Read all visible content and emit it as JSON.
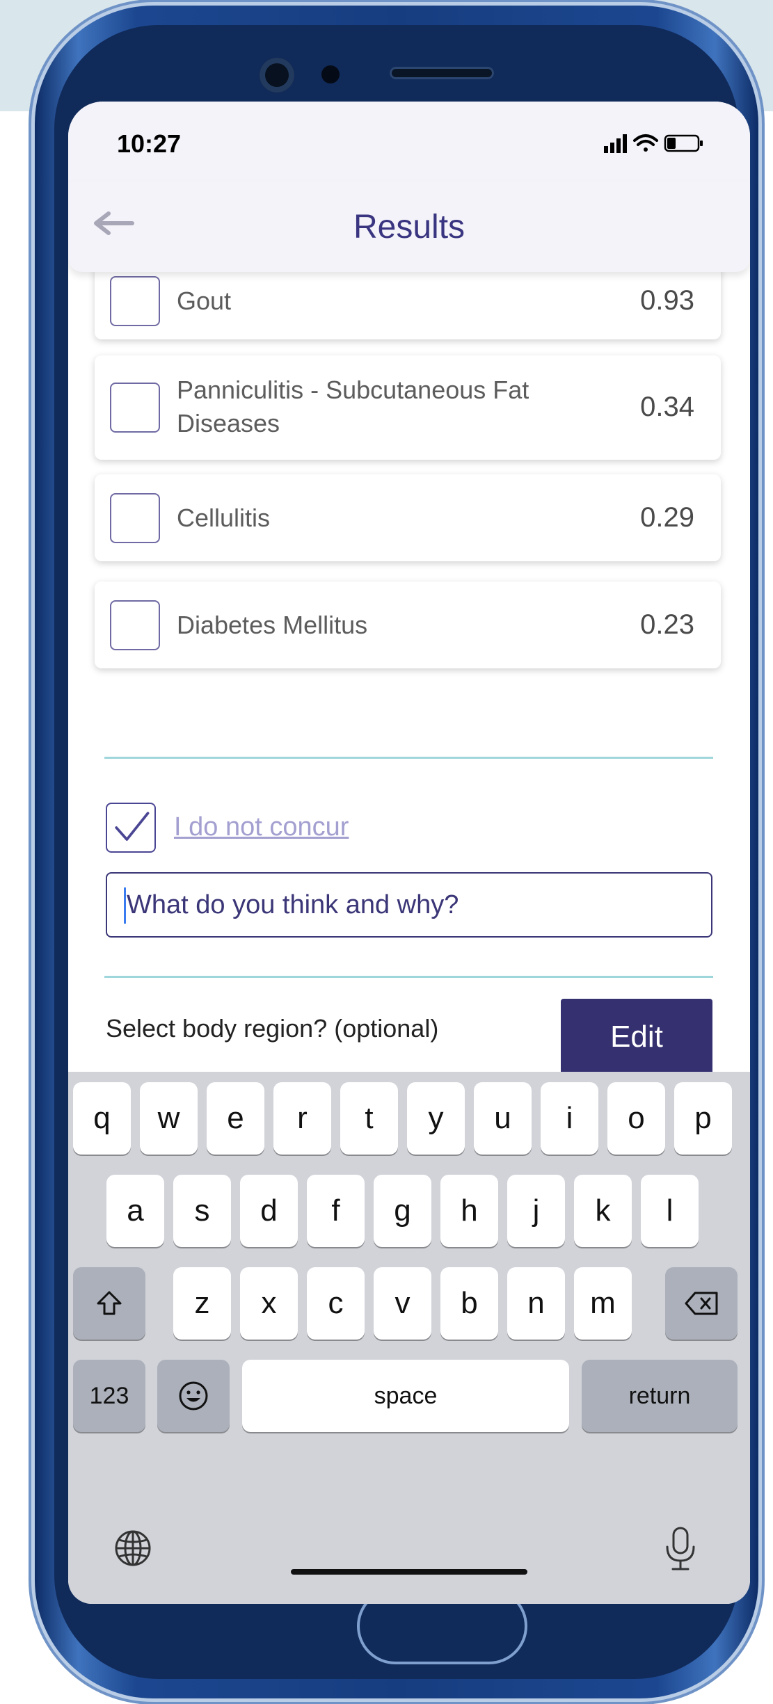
{
  "status_bar": {
    "time": "10:27"
  },
  "header": {
    "title": "Results"
  },
  "results": [
    {
      "name": "Gout",
      "score": "0.93"
    },
    {
      "name": "Panniculitis - Subcutaneous Fat Diseases",
      "score": "0.34"
    },
    {
      "name": "Cellulitis",
      "score": "0.29"
    },
    {
      "name": "Diabetes Mellitus",
      "score": "0.23"
    }
  ],
  "concur": {
    "label": "I do not concur",
    "checked": true
  },
  "comment": {
    "placeholder": "What do you think and why?"
  },
  "body_region": {
    "label": "Select body region? (optional)",
    "edit_label": "Edit"
  },
  "keyboard": {
    "row1": [
      "q",
      "w",
      "e",
      "r",
      "t",
      "y",
      "u",
      "i",
      "o",
      "p"
    ],
    "row2": [
      "a",
      "s",
      "d",
      "f",
      "g",
      "h",
      "j",
      "k",
      "l"
    ],
    "row3": [
      "z",
      "x",
      "c",
      "v",
      "b",
      "n",
      "m"
    ],
    "numbers_label": "123",
    "space_label": "space",
    "return_label": "return"
  },
  "colors": {
    "accent": "#35306f",
    "title": "#3a3580",
    "divider": "#9fd6dc",
    "link": "#a39fd0"
  }
}
